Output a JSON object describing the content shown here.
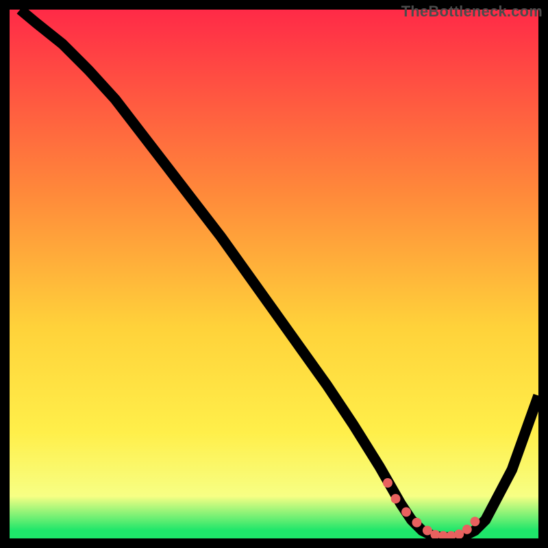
{
  "watermark": "TheBottleneck.com",
  "colors": {
    "bg": "#000000",
    "grad_top": "#ff2a47",
    "grad_mid_upper": "#ff8a3a",
    "grad_mid": "#ffd23a",
    "grad_mid_lower": "#ffef4a",
    "grad_low_yellow": "#f7ff84",
    "grad_green": "#1ee66a",
    "curve": "#000000",
    "marker": "#e8615f",
    "watermark": "#4b4b4b"
  },
  "chart_data": {
    "type": "line",
    "title": "",
    "xlabel": "",
    "ylabel": "",
    "xlim": [
      0,
      100
    ],
    "ylim": [
      0,
      100
    ],
    "x": [
      2,
      5,
      10,
      15,
      20,
      25,
      30,
      35,
      40,
      45,
      50,
      55,
      60,
      65,
      70,
      72,
      74,
      76,
      78,
      80,
      82,
      84,
      86,
      88,
      90,
      95,
      100
    ],
    "y": [
      100,
      97.5,
      93.5,
      88.5,
      83,
      76.5,
      70,
      63.5,
      57,
      50,
      43,
      36,
      29,
      21.5,
      13.5,
      10,
      6.5,
      3.5,
      1.5,
      0.5,
      0.2,
      0.2,
      0.5,
      1.5,
      3.5,
      13,
      27
    ],
    "valley_markers_x": [
      71.5,
      73,
      75,
      77,
      79,
      80.5,
      82,
      83.5,
      85,
      86.5,
      88
    ],
    "valley_markers_y": [
      10.5,
      7.5,
      5,
      3,
      1.5,
      0.7,
      0.5,
      0.5,
      0.8,
      1.7,
      3.2
    ],
    "gradient_stops": [
      {
        "offset": 0.0,
        "key": "grad_top"
      },
      {
        "offset": 0.35,
        "key": "grad_mid_upper"
      },
      {
        "offset": 0.6,
        "key": "grad_mid"
      },
      {
        "offset": 0.8,
        "key": "grad_mid_lower"
      },
      {
        "offset": 0.92,
        "key": "grad_low_yellow"
      },
      {
        "offset": 0.985,
        "key": "grad_green"
      },
      {
        "offset": 1.0,
        "key": "grad_green"
      }
    ]
  }
}
